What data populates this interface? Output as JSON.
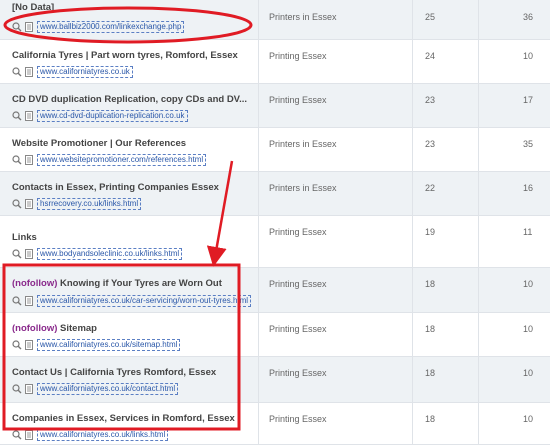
{
  "rows": [
    {
      "title": "[No Data]",
      "url": "www.ballbiz2000.com/linkexchange.php",
      "category": "Printers in Essex",
      "c3": "25",
      "c4": "36"
    },
    {
      "title": "California Tyres | Part worn tyres, Romford, Essex",
      "url": "www.californiatyres.co.uk",
      "category": "Printing Essex",
      "c3": "24",
      "c4": "10"
    },
    {
      "title": "CD DVD duplication Replication, copy CDs and DV...",
      "url": "www.cd-dvd-duplication-replication.co.uk",
      "category": "Printing Essex",
      "c3": "23",
      "c4": "17"
    },
    {
      "title": "Website Promotioner | Our References",
      "url": "www.websitepromotioner.com/references.html",
      "category": "Printers in Essex",
      "c3": "23",
      "c4": "35"
    },
    {
      "title": "Contacts in Essex, Printing Companies Essex",
      "url": "hsrrecovery.co.uk/links.html",
      "category": "Printers in Essex",
      "c3": "22",
      "c4": "16"
    },
    {
      "title": "Links",
      "url": "www.bodyandsoleclinic.co.uk/links.html",
      "category": "Printing Essex",
      "c3": "19",
      "c4": "11"
    },
    {
      "tag": "(nofollow)",
      "title": "Knowing if Your Tyres are Worn Out",
      "url": "www.californiatyres.co.uk/car-servicing/worn-out-tyres.html",
      "category": "Printing Essex",
      "c3": "18",
      "c4": "10"
    },
    {
      "tag": "(nofollow)",
      "title": "Sitemap",
      "url": "www.californiatyres.co.uk/sitemap.html",
      "category": "Printing Essex",
      "c3": "18",
      "c4": "10"
    },
    {
      "title": "Contact Us | California Tyres Romford, Essex",
      "url": "www.californiatyres.co.uk/contact.html",
      "category": "Printing Essex",
      "c3": "18",
      "c4": "10"
    },
    {
      "title": "Companies in Essex, Services in Romford, Essex",
      "url": "www.californiatyres.co.uk/links.html",
      "category": "Printing Essex",
      "c3": "18",
      "c4": "10"
    }
  ],
  "annotation_color": "#e01b24",
  "icons": {
    "preview": "magnifier-icon",
    "page": "page-icon"
  }
}
